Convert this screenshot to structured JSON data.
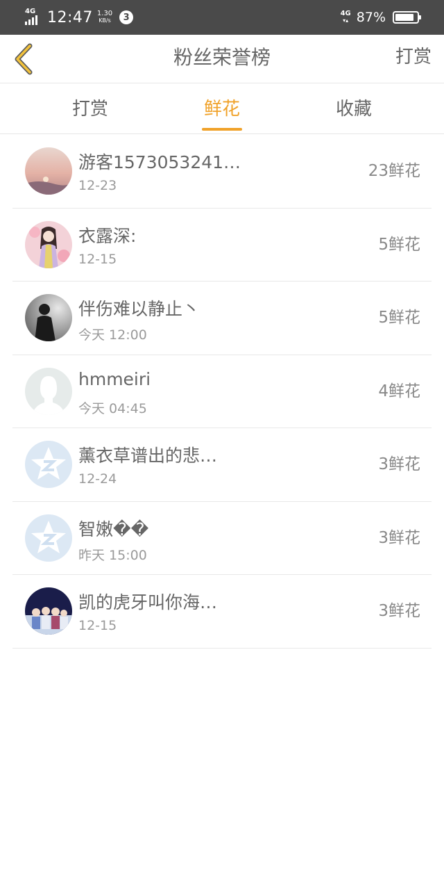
{
  "status_bar": {
    "network_left": "4G",
    "time": "12:47",
    "speed_value": "1.30",
    "speed_unit": "KB/s",
    "notification_count": "3",
    "network_right": "4G",
    "battery": "87%",
    "battery_level": 0.87
  },
  "header": {
    "title": "粉丝荣誉榜",
    "action": "打赏",
    "back_icon": "chevron-left-icon"
  },
  "tabs": [
    {
      "label": "打赏",
      "active": false
    },
    {
      "label": "鲜花",
      "active": true
    },
    {
      "label": "收藏",
      "active": false
    }
  ],
  "colors": {
    "accent": "#f0a22a",
    "status_bar": "#4a4a4a",
    "text": "#666666",
    "subtext": "#9a9a9a"
  },
  "fans": [
    {
      "name": "游客1573053241…",
      "date": "12-23",
      "count": "23鲜花",
      "avatar": "sunset-photo"
    },
    {
      "name": "衣露深:",
      "date": "12-15",
      "count": "5鲜花",
      "avatar": "illustrated-girl"
    },
    {
      "name": "伴伤难以静止丶",
      "date": "今天 12:00",
      "count": "5鲜花",
      "avatar": "silhouette-photo"
    },
    {
      "name": "hmmeiri",
      "date": "今天 04:45",
      "count": "4鲜花",
      "avatar": "default-person-icon"
    },
    {
      "name": "薰衣草谱出的悲…",
      "date": "12-24",
      "count": "3鲜花",
      "avatar": "qzone-star-icon"
    },
    {
      "name": "智嫩��",
      "date": "昨天 15:00",
      "count": "3鲜花",
      "avatar": "qzone-star-icon"
    },
    {
      "name": "凯的虎牙叫你海…",
      "date": "12-15",
      "count": "3鲜花",
      "avatar": "group-photo"
    }
  ]
}
